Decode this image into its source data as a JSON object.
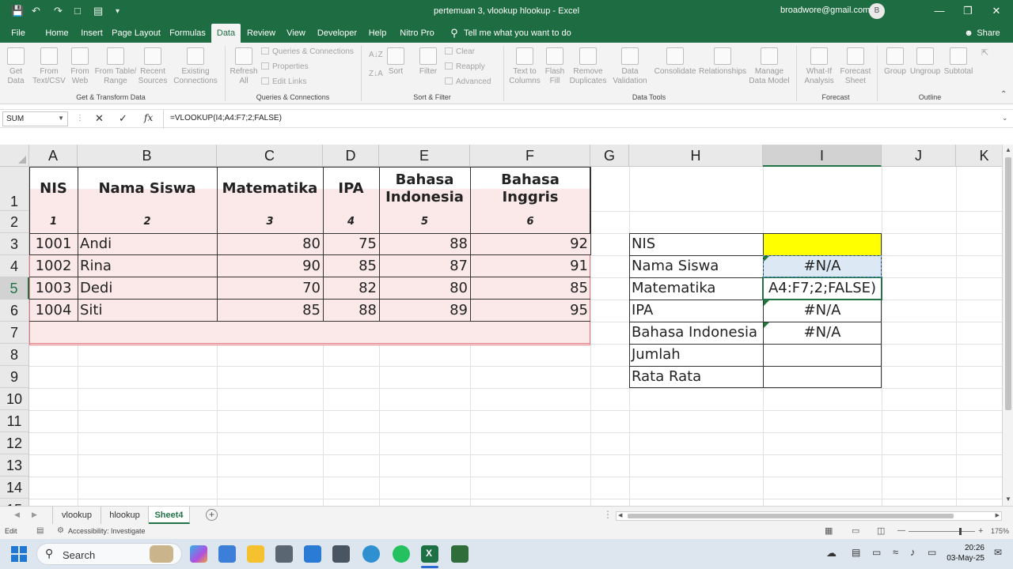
{
  "app": {
    "title": "pertemuan 3, vlookup hlookup  -  Excel",
    "account": "broadwore@gmail.com",
    "avatar": "B"
  },
  "ribbon_tabs": [
    "File",
    "Home",
    "Insert",
    "Page Layout",
    "Formulas",
    "Data",
    "Review",
    "View",
    "Developer",
    "Help",
    "Nitro Pro",
    "Tell me what you want to do"
  ],
  "share_label": "Share",
  "ribbon": {
    "get_data": "Get\nData",
    "from_text": "From\nText/CSV",
    "from_web": "From\nWeb",
    "from_table": "From Table/\nRange",
    "recent_sources": "Recent\nSources",
    "existing_connections": "Existing\nConnections",
    "refresh_all": "Refresh\nAll",
    "queries_connections": "Queries & Connections",
    "properties": "Properties",
    "edit_links": "Edit Links",
    "sort": "Sort",
    "filter": "Filter",
    "clear": "Clear",
    "reapply": "Reapply",
    "advanced": "Advanced",
    "text_to_columns": "Text to\nColumns",
    "flash_fill": "Flash\nFill",
    "remove_duplicates": "Remove\nDuplicates",
    "data_validation": "Data\nValidation",
    "consolidate": "Consolidate",
    "relationships": "Relationships",
    "manage_data_model": "Manage\nData Model",
    "what_if": "What-If\nAnalysis",
    "forecast_sheet": "Forecast\nSheet",
    "group": "Group",
    "ungroup": "Ungroup",
    "subtotal": "Subtotal",
    "groups": [
      "Get & Transform Data",
      "Queries & Connections",
      "Sort & Filter",
      "Data Tools",
      "Forecast",
      "Outline"
    ]
  },
  "formula_bar": {
    "name_box": "SUM",
    "formula": "=VLOOKUP(I4;A4:F7;2;FALSE)"
  },
  "columns": [
    "A",
    "B",
    "C",
    "D",
    "E",
    "F",
    "G",
    "H",
    "I",
    "J",
    "K"
  ],
  "rows": [
    "1",
    "2",
    "3",
    "4",
    "5",
    "6",
    "7",
    "8",
    "9",
    "10",
    "11",
    "12",
    "13",
    "14",
    "15"
  ],
  "table": {
    "headers": [
      "NIS",
      "Nama Siswa",
      "Matematika",
      "IPA",
      "Bahasa Indonesia",
      "Bahasa Inggris"
    ],
    "indexes": [
      "1",
      "2",
      "3",
      "4",
      "5",
      "6"
    ],
    "rows": [
      [
        "1001",
        "Andi",
        "80",
        "75",
        "88",
        "92"
      ],
      [
        "1002",
        "Rina",
        "90",
        "85",
        "87",
        "91"
      ],
      [
        "1003",
        "Dedi",
        "70",
        "82",
        "80",
        "85"
      ],
      [
        "1004",
        "Siti",
        "85",
        "88",
        "89",
        "95"
      ]
    ]
  },
  "lookup": {
    "labels": [
      "NIS",
      "Nama Siswa",
      "Matematika",
      "IPA",
      "Bahasa Indonesia",
      "Jumlah",
      "Rata Rata"
    ],
    "values": [
      "",
      "#N/A",
      "A4:F7;2;FALSE)",
      "#N/A",
      "#N/A",
      "",
      ""
    ]
  },
  "sheets": [
    "vlookup",
    "hlookup",
    "Sheet4"
  ],
  "status": {
    "mode": "Edit",
    "accessibility": "Accessibility: Investigate",
    "zoom": "175%"
  },
  "taskbar": {
    "search": "Search",
    "time": "20:26",
    "date": "03-May-25"
  },
  "colors": {
    "excel_green": "#1e6c41",
    "highlight_yellow": "#ffff00",
    "table_fill": "#fbe9ea"
  }
}
